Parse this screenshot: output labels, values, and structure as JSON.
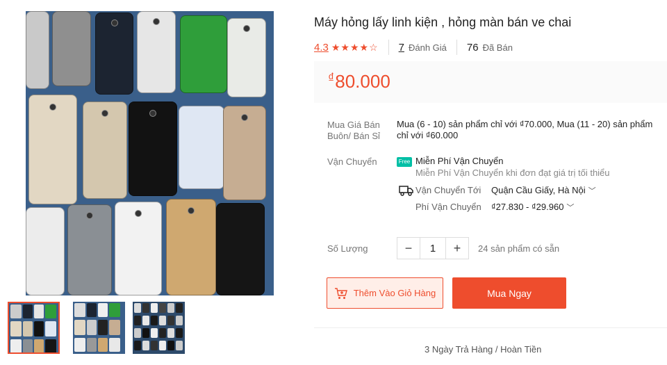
{
  "product": {
    "title": "Máy hỏng lấy linh kiện , hỏng màn bán ve chai",
    "rating": "4.3",
    "stars": "★★★★☆",
    "reviews_count": "7",
    "reviews_label": "Đánh Giá",
    "sold_count": "76",
    "sold_label": "Đã Bán",
    "currency": "₫",
    "price": "80.000"
  },
  "wholesale": {
    "label": "Mua Giá Bán Buôn/ Bán Sỉ",
    "text": "Mua (6 - 10) sản phẩm chỉ với ₫70.000, Mua (11 - 20) sản phẩm chỉ với ₫60.000"
  },
  "shipping": {
    "label": "Vận Chuyển",
    "free_badge": "Free",
    "free_title": "Miễn Phí Vận Chuyển",
    "free_desc": "Miễn Phí Vận Chuyển khi đơn đạt giá trị tối thiểu",
    "to_label": "Vận Chuyển Tới",
    "to_value": "Quận Cầu Giấy, Hà Nội",
    "fee_label": "Phí Vận Chuyển",
    "fee_value": "₫27.830 - ₫29.960"
  },
  "quantity": {
    "label": "Số Lượng",
    "minus": "−",
    "value": "1",
    "plus": "+",
    "stock": "24 sản phẩm có sẵn"
  },
  "actions": {
    "add_to_cart": "Thêm Vào Giỏ Hàng",
    "buy_now": "Mua Ngay"
  },
  "footer": {
    "return_policy": "3 Ngày Trả Hàng / Hoàn Tiền"
  },
  "colors": {
    "accent": "#ee4d2d",
    "free_ship": "#00bfa5"
  }
}
